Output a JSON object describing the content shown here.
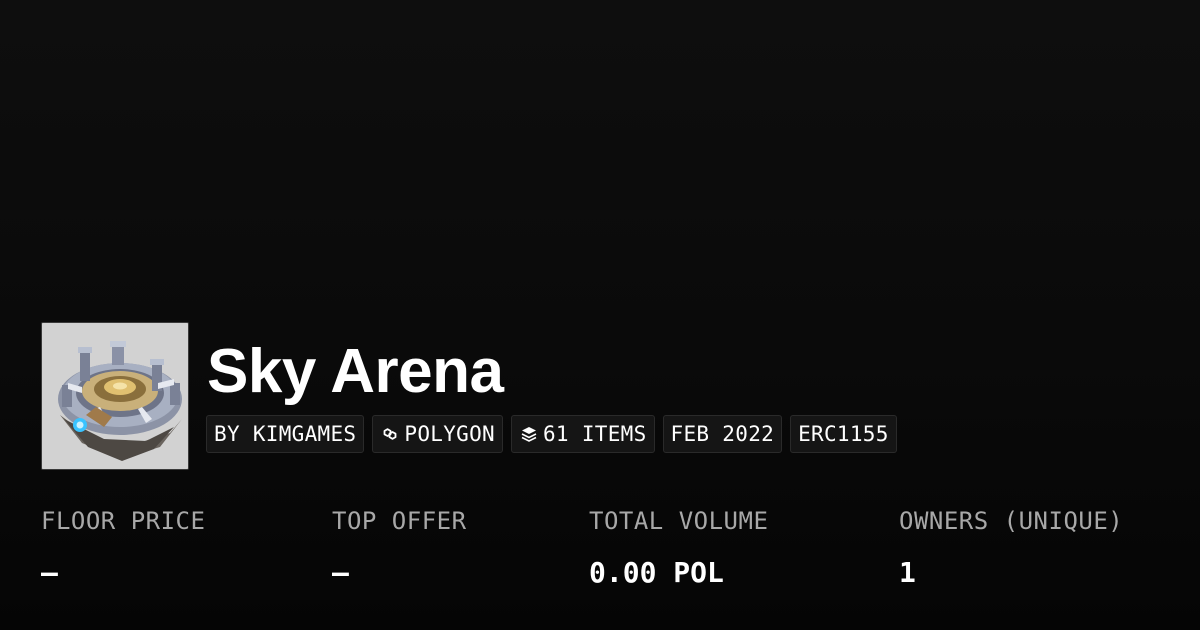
{
  "collection": {
    "name": "Sky Arena",
    "image_alt": "collection-thumbnail"
  },
  "badges": {
    "creator": "BY KIMGAMES",
    "chain": {
      "label": "POLYGON",
      "icon": "polygon-chain-icon"
    },
    "items": {
      "label": "61 ITEMS",
      "icon": "layers-icon"
    },
    "date": "FEB 2022",
    "standard": "ERC1155"
  },
  "stats": [
    {
      "label": "FLOOR PRICE",
      "value": "—"
    },
    {
      "label": "TOP OFFER",
      "value": "—"
    },
    {
      "label": "TOTAL VOLUME",
      "value": "0.00 POL"
    },
    {
      "label": "OWNERS (UNIQUE)",
      "value": "1"
    }
  ],
  "colors": {
    "background": "#0a0a0a",
    "text": "#ffffff",
    "muted_text": "#a8a8a8",
    "badge_background": "#151515"
  }
}
